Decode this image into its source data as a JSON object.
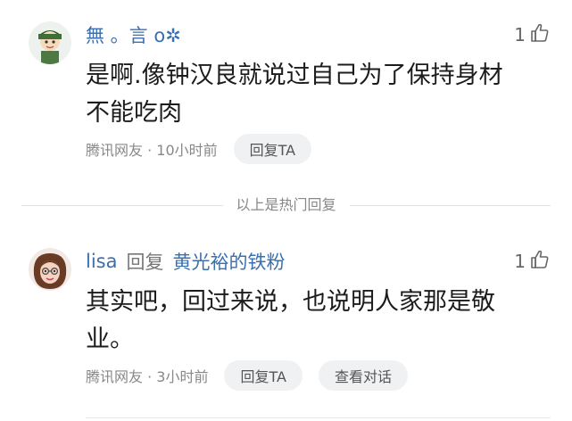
{
  "comments": [
    {
      "username": "無 。言 o✲",
      "likes": "1",
      "text_lines": [
        "是啊.像钟汉良就说过自己为了保持身材",
        "不能吃肉"
      ],
      "source": "腾讯网友 · 10小时前",
      "reply_label": "回复TA"
    },
    {
      "username": "lisa",
      "reply_word": "回复",
      "reply_target": "黄光裕的铁粉",
      "likes": "1",
      "text_lines": [
        "其实吧，回过来说，也说明人家那是敬",
        "业。"
      ],
      "source": "腾讯网友 · 3小时前",
      "reply_label": "回复TA",
      "view_conversation_label": "查看对话"
    }
  ],
  "divider_label": "以上是热门回复",
  "colors": {
    "username": "#3a6fb0",
    "pill_bg": "#f0f1f3"
  },
  "icons": {
    "like": "thumbs-up-icon"
  }
}
